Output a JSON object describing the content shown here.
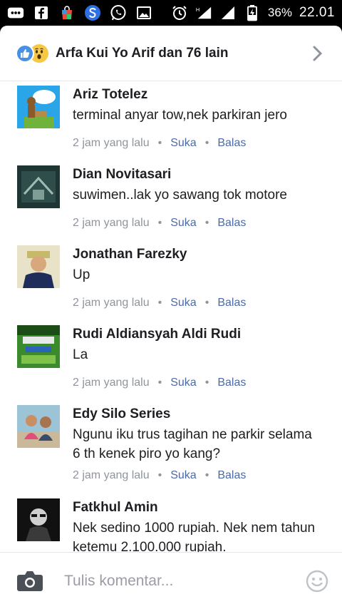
{
  "status_bar": {
    "battery": "36%",
    "time": "22.01",
    "network": "H"
  },
  "header": {
    "title": "Arfa Kui Yo Arif dan 76 lain"
  },
  "comments": [
    {
      "name": "Ariz Totelez",
      "text": "terminal anyar tow,nek parkiran jero",
      "time": "2 jam yang lalu",
      "like": "Suka",
      "reply": "Balas"
    },
    {
      "name": "Dian Novitasari",
      "text": "suwimen..lak yo sawang tok motore",
      "time": "2 jam yang lalu",
      "like": "Suka",
      "reply": "Balas"
    },
    {
      "name": "Jonathan Farezky",
      "text": "Up",
      "time": "2 jam yang lalu",
      "like": "Suka",
      "reply": "Balas"
    },
    {
      "name": "Rudi Aldiansyah Aldi Rudi",
      "text": "La",
      "time": "2 jam yang lalu",
      "like": "Suka",
      "reply": "Balas"
    },
    {
      "name": "Edy Silo Series",
      "text": "Ngunu iku trus tagihan ne parkir selama 6 th kenek piro yo kang?",
      "time": "2 jam yang lalu",
      "like": "Suka",
      "reply": "Balas"
    },
    {
      "name": "Fatkhul Amin",
      "text": "Nek sedino 1000 rupiah. Nek nem tahun ketemu 2.100.000 rupiah.",
      "time": "",
      "like": "",
      "reply": ""
    }
  ],
  "composer": {
    "placeholder": "Tulis komentar..."
  },
  "colors": {
    "link": "#4b6aa8",
    "meta": "#90949c",
    "like_reaction": "#4a90e2",
    "wow_reaction": "#f7c844"
  }
}
